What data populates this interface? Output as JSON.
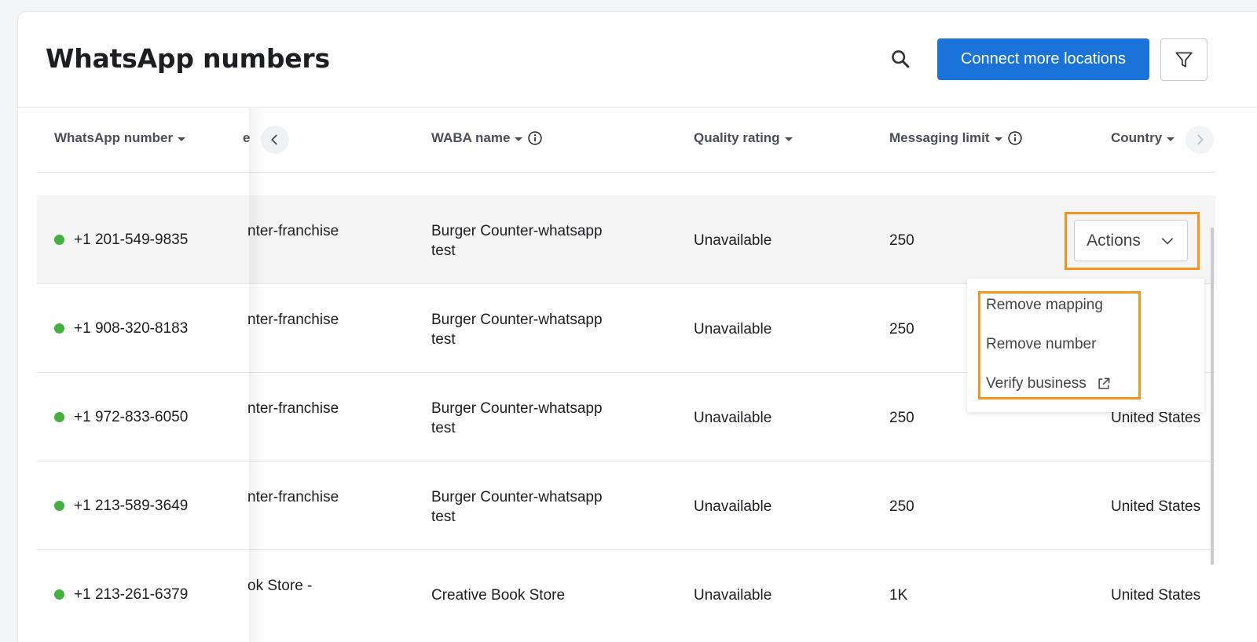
{
  "header": {
    "title": "WhatsApp numbers",
    "connect_label": "Connect more locations"
  },
  "columns": {
    "whatsapp_number": "WhatsApp number",
    "truncated_name": "e",
    "waba_name": "WABA name",
    "quality_rating": "Quality rating",
    "messaging_limit": "Messaging limit",
    "country": "Country"
  },
  "rows": [
    {
      "number": "+1 201-549-9835",
      "name": "nter-franchise",
      "waba": [
        "Burger Counter-whatsapp",
        "test"
      ],
      "quality": "Unavailable",
      "limit": "250",
      "country": ""
    },
    {
      "number": "+1 908-320-8183",
      "name": "nter-franchise",
      "waba": [
        "Burger Counter-whatsapp",
        "test"
      ],
      "quality": "Unavailable",
      "limit": "250",
      "country": ""
    },
    {
      "number": "+1 972-833-6050",
      "name": "nter-franchise",
      "waba": [
        "Burger Counter-whatsapp",
        "test"
      ],
      "quality": "Unavailable",
      "limit": "250",
      "country": "United States"
    },
    {
      "number": "+1 213-589-3649",
      "name": "nter-franchise",
      "waba": [
        "Burger Counter-whatsapp",
        "test"
      ],
      "quality": "Unavailable",
      "limit": "250",
      "country": "United States"
    },
    {
      "number": "+1 213-261-6379",
      "name": "ok Store -",
      "waba": [
        "Creative Book Store",
        ""
      ],
      "quality": "Unavailable",
      "limit": "1K",
      "country": "United States"
    }
  ],
  "actions": {
    "label": "Actions",
    "menu": {
      "remove_mapping": "Remove mapping",
      "remove_number": "Remove number",
      "verify_business": "Verify business"
    }
  },
  "colors": {
    "primary": "#1a73d9",
    "status_active": "#45b03f",
    "highlight": "#f7941d"
  }
}
